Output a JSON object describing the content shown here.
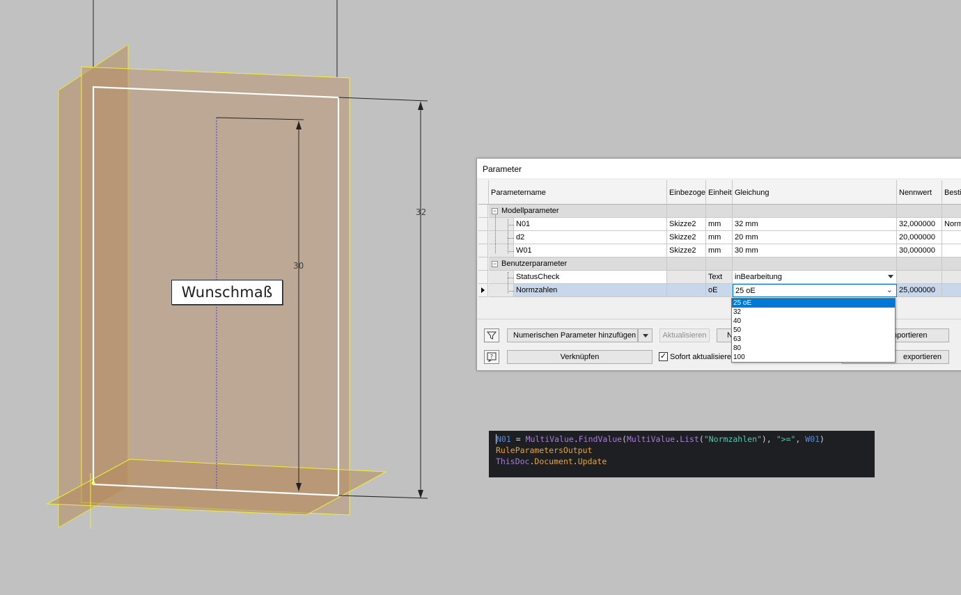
{
  "viewport": {
    "callout_label": "Wunschmaß",
    "dimension_outer": "32",
    "dimension_inner": "30",
    "colors": {
      "background": "#c1c1c1",
      "plane_fill": "#b58a5e",
      "highlight": "#ffff33"
    }
  },
  "dialog": {
    "title": "Parameter",
    "columns": [
      "Parametername",
      "Einbezoge",
      "Einheit",
      "Gleichung",
      "Nennwert",
      "Besti"
    ],
    "groups": {
      "model": "Modellparameter",
      "user": "Benutzerparameter"
    },
    "rows": [
      {
        "name": "N01",
        "ref": "Skizze2",
        "unit": "mm",
        "equation": "32 mm",
        "nominal": "32,000000",
        "extra": "Norm"
      },
      {
        "name": "d2",
        "ref": "Skizze2",
        "unit": "mm",
        "equation": "20 mm",
        "nominal": "20,000000",
        "extra": ""
      },
      {
        "name": "W01",
        "ref": "Skizze2",
        "unit": "mm",
        "equation": "30 mm",
        "nominal": "30,000000",
        "extra": ""
      },
      {
        "name": "StatusCheck",
        "ref": "",
        "unit": "Text",
        "equation": "inBearbeitung",
        "nominal": "",
        "extra": ""
      },
      {
        "name": "Normzahlen",
        "ref": "",
        "unit": "oE",
        "equation": "25 oE",
        "nominal": "25,000000",
        "extra": ""
      }
    ],
    "dropdown_options": [
      "25 oE",
      "32",
      "40",
      "50",
      "63",
      "80",
      "100"
    ],
    "buttons": {
      "add_numeric": "Numerischen Parameter hinzufügen",
      "update": "Aktualisieren",
      "n_partial": "N",
      "import_partial": "nportieren",
      "link": "Verknüpfen",
      "immediate_update": "Sofort aktualisieren",
      "export_partial": "exportieren"
    },
    "immediate_update_checked": true
  },
  "code": {
    "line1": {
      "target": "N01",
      "eq": " = ",
      "cls1": "MultiValue",
      "dot1": ".",
      "method1": "FindValue",
      "p1": "(",
      "cls2": "MultiValue",
      "dot2": ".",
      "method2": "List",
      "p2": "(",
      "str1": "\"Normzahlen\"",
      "p3": "), ",
      "str2": "\">=\"",
      "comma": ", ",
      "arg": "W01",
      "p4": ")"
    },
    "line2": "RuleParametersOutput",
    "line3": {
      "obj": "ThisDoc",
      "dot1": ".",
      "prop": "Document",
      "dot2": ".",
      "method": "Update"
    }
  }
}
